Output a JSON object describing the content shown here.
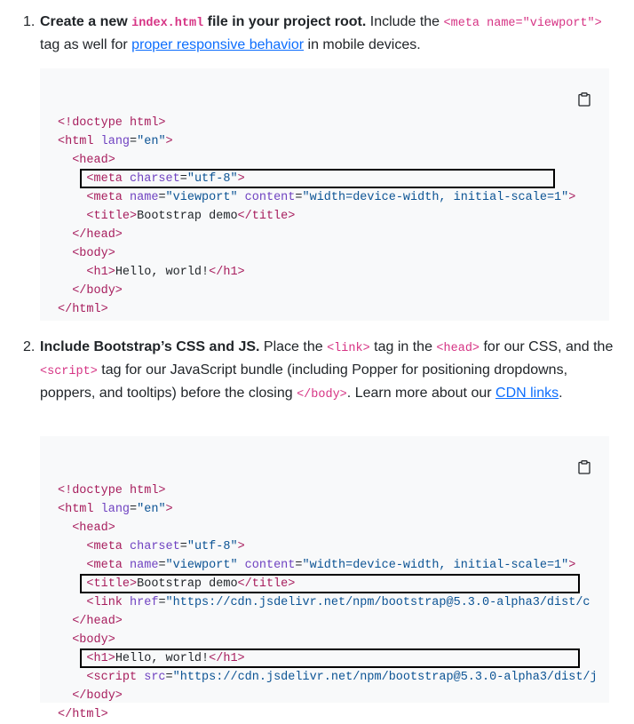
{
  "step1": {
    "number": "1.",
    "lead": "Create a new",
    "file": "index.html",
    "lead2": "file in your project root.",
    "text_a": "Include the",
    "meta_tag": "<meta name=\"viewport\">",
    "text_b": "tag as well for",
    "link": "proper responsive behavior",
    "text_c": "in mobile devices."
  },
  "code1": {
    "l1_tag": "<!doctype html>",
    "l2_open": "<html",
    "l2_attr": "lang",
    "l2_val": "\"en\"",
    "l3": "<head>",
    "l4_open": "<meta",
    "l4_attr": "charset",
    "l4_val": "\"utf-8\"",
    "l5_open": "<meta",
    "l5_attr1": "name",
    "l5_val1": "\"viewport\"",
    "l5_attr2": "content",
    "l5_val2": "\"width=device-width, initial-scale=1\"",
    "l6_open": "<title>",
    "l6_text": "Bootstrap demo",
    "l6_close": "</title>",
    "l7": "</head>",
    "l8": "<body>",
    "l9_open": "<h1>",
    "l9_text": "Hello, world!",
    "l9_close": "</h1>",
    "l10": "</body>",
    "l11": "</html>"
  },
  "step2": {
    "number": "2.",
    "lead": "Include Bootstrap’s CSS and JS.",
    "text_a": "Place the",
    "link_tag": "<link>",
    "text_b": "tag in the",
    "head_tag": "<head>",
    "text_c": "for our CSS, and the",
    "script_tag": "<script>",
    "text_d": "tag for our JavaScript bundle (including Popper for positioning dropdowns, poppers, and tooltips) before the closing",
    "body_close": "</body>",
    "text_e": ". Learn more about our",
    "link": "CDN links",
    "text_f": "."
  },
  "code2": {
    "l1_tag": "<!doctype html>",
    "l2_open": "<html",
    "l2_attr": "lang",
    "l2_val": "\"en\"",
    "l3": "<head>",
    "l4_open": "<meta",
    "l4_attr": "charset",
    "l4_val": "\"utf-8\"",
    "l5_open": "<meta",
    "l5_attr1": "name",
    "l5_val1": "\"viewport\"",
    "l5_attr2": "content",
    "l5_val2": "\"width=device-width, initial-scale=1\"",
    "l6_open": "<title>",
    "l6_text": "Bootstrap demo",
    "l6_close": "</title>",
    "l7_open": "<link",
    "l7_attr": "href",
    "l7_val": "\"https://cdn.jsdelivr.net/npm/bootstrap@5.3.0-alpha3/dist/c",
    "l8": "</head>",
    "l9": "<body>",
    "l10_open": "<h1>",
    "l10_text": "Hello, world!",
    "l10_close": "</h1>",
    "l11_open": "<script",
    "l11_attr": "src",
    "l11_val": "\"https://cdn.jsdelivr.net/npm/bootstrap@5.3.0-alpha3/dist/j",
    "l12": "</body>",
    "l13": "</html>"
  },
  "icons": {
    "copy": "clipboard-icon"
  }
}
